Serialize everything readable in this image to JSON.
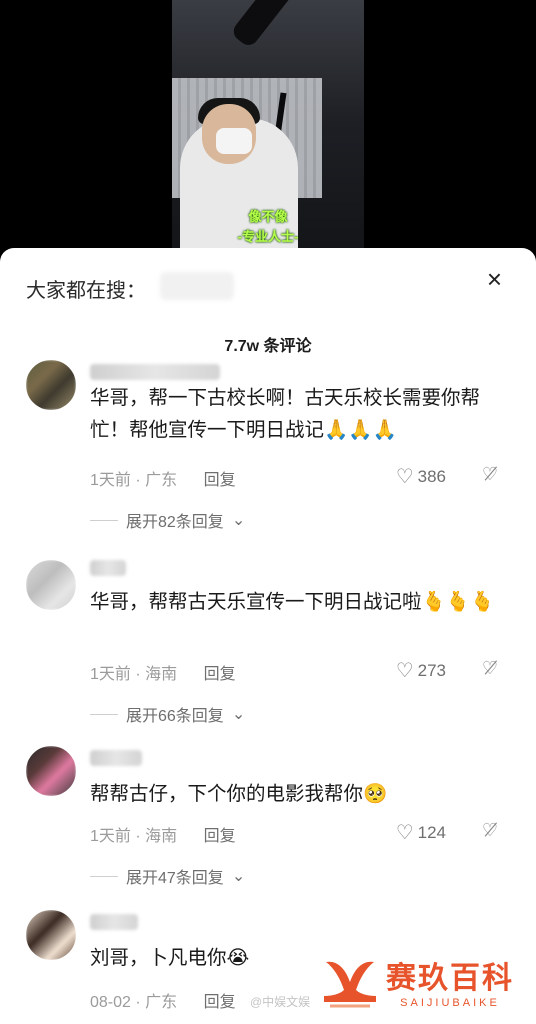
{
  "video": {
    "subtitle_line1": "像不像",
    "subtitle_line2": "-专业人士-"
  },
  "search": {
    "label": "大家都在搜："
  },
  "close_icon": "×",
  "comment_count": "7.7w 条评论",
  "comments": [
    {
      "text": "华哥，帮一下古校长啊！古天乐校长需要你帮忙！帮他宣传一下明日战记🙏🙏🙏",
      "time": "1天前",
      "location": "广东",
      "reply_label": "回复",
      "likes": "386",
      "expand": "展开82条回复"
    },
    {
      "text": "华哥，帮帮古天乐宣传一下明日战记啦🫰🫰🫰",
      "time": "1天前",
      "location": "海南",
      "reply_label": "回复",
      "likes": "273",
      "expand": "展开66条回复"
    },
    {
      "text": "帮帮古仔，下个你的电影我帮你🥺",
      "time": "1天前",
      "location": "海南",
      "reply_label": "回复",
      "likes": "124",
      "expand": "展开47条回复"
    },
    {
      "text": "刘哥，卜凡电你😭",
      "time": "08-02",
      "location": "广东",
      "reply_label": "回复"
    }
  ],
  "watermark": {
    "cn": "赛玖百科",
    "en": "SAIJIUBAIKE",
    "weibo": "@中娱文娱"
  },
  "colors": {
    "brand": "#e7542b",
    "subtitle": "#b6ff4a"
  },
  "icons": [
    "close-icon",
    "heart-icon",
    "broken-heart-icon",
    "chevron-down-icon"
  ]
}
